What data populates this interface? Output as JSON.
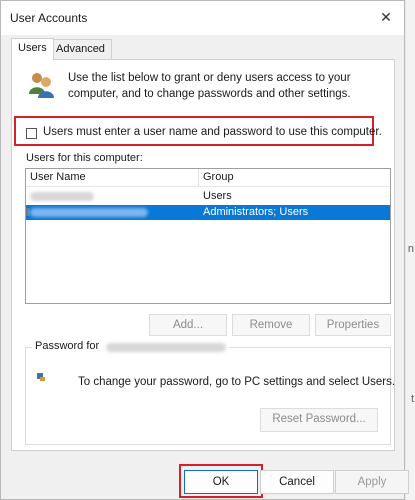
{
  "window": {
    "title": "User Accounts"
  },
  "tabs": [
    {
      "label": "Users",
      "active": true
    },
    {
      "label": "Advanced",
      "active": false
    }
  ],
  "description": "Use the list below to grant or deny users access to your computer, and to change passwords and other settings.",
  "checkbox": {
    "label": "Users must enter a user name and password to use this computer.",
    "checked": false
  },
  "users_section_label": "Users for this computer:",
  "table": {
    "columns": [
      "User Name",
      "Group"
    ],
    "rows": [
      {
        "group": "Users",
        "selected": false
      },
      {
        "group": "Administrators; Users",
        "selected": true
      }
    ]
  },
  "list_buttons": {
    "add": "Add...",
    "remove": "Remove",
    "properties": "Properties"
  },
  "password": {
    "group_label": "Password for",
    "text": "To change your password, go to PC settings and select Users.",
    "reset_button": "Reset Password..."
  },
  "footer": {
    "ok": "OK",
    "cancel": "Cancel",
    "apply": "Apply"
  },
  "colors": {
    "highlight": "#d2232a",
    "selection": "#0a78d7"
  }
}
